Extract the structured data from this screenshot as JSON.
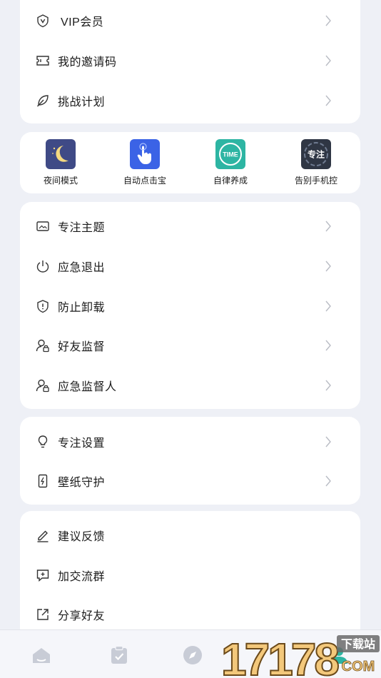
{
  "card_top": {
    "items": [
      {
        "label": "VIP会员",
        "icon": "vip-shield-icon"
      },
      {
        "label": "我的邀请码",
        "icon": "ticket-icon"
      },
      {
        "label": "挑战计划",
        "icon": "leaf-icon"
      }
    ]
  },
  "features": [
    {
      "label": "夜间模式",
      "icon": "moon-icon",
      "color": "#3f4a86"
    },
    {
      "label": "自动点击宝",
      "icon": "tap-hand-icon",
      "color": "#3b63e6"
    },
    {
      "label": "自律养成",
      "icon": "time-badge-icon",
      "badge": "TIME",
      "color": "#2db5a3"
    },
    {
      "label": "告别手机控",
      "icon": "focus-badge-icon",
      "badge": "专注",
      "color": "#2f3644"
    }
  ],
  "card_mid": {
    "items": [
      {
        "label": "专注主题",
        "icon": "image-icon"
      },
      {
        "label": "应急退出",
        "icon": "power-icon"
      },
      {
        "label": "防止卸载",
        "icon": "shield-exclaim-icon"
      },
      {
        "label": "好友监督",
        "icon": "user-lock-icon"
      },
      {
        "label": "应急监督人",
        "icon": "user-lock-icon"
      }
    ]
  },
  "card_settings": {
    "items": [
      {
        "label": "专注设置",
        "icon": "bulb-icon"
      },
      {
        "label": "壁纸守护",
        "icon": "phone-bolt-icon"
      }
    ]
  },
  "card_bottom": {
    "items": [
      {
        "label": "建议反馈",
        "icon": "pen-icon"
      },
      {
        "label": "加交流群",
        "icon": "chat-plus-icon"
      },
      {
        "label": "分享好友",
        "icon": "share-icon"
      }
    ]
  },
  "tabbar": {
    "tabs": [
      {
        "icon": "home-icon"
      },
      {
        "icon": "clipboard-check-icon"
      },
      {
        "icon": "compass-icon"
      },
      {
        "icon": "profile-icon"
      }
    ]
  },
  "watermark": {
    "text": "17178",
    "sub": "下载站",
    "domain": "COM"
  },
  "colors": {
    "accent": "#3b63e6",
    "icon_gray": "#c8ccd6",
    "page_bg": "#eef0f6"
  }
}
